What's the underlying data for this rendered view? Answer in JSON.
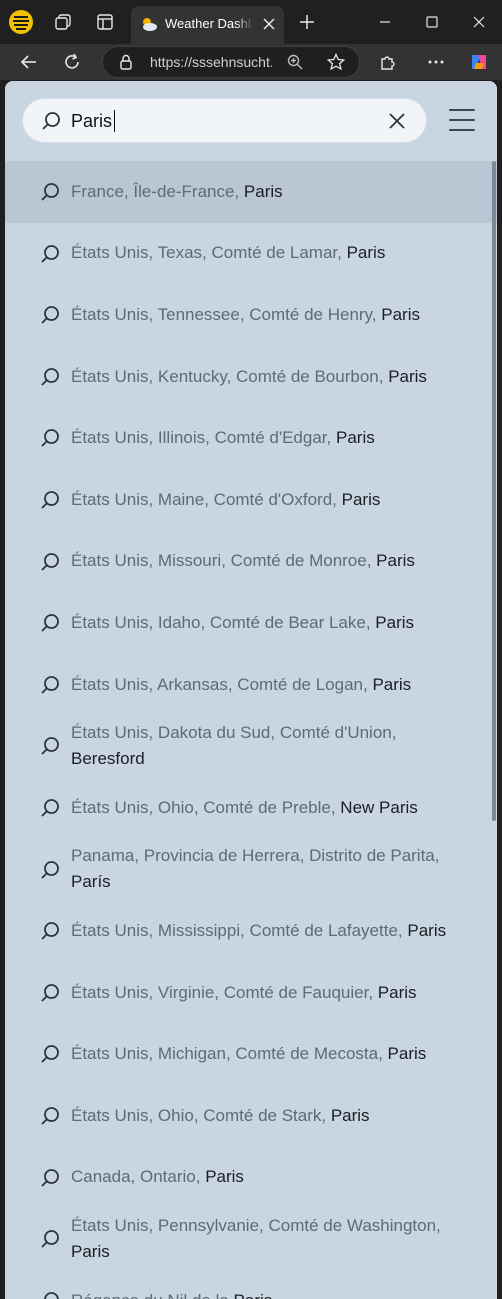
{
  "browser": {
    "tab_title": "Weather Dashboard",
    "url": "https://sssehnsucht.github.io"
  },
  "search": {
    "value": "Paris"
  },
  "results": [
    {
      "region": "France, Île-de-France, ",
      "place": "Paris",
      "selected": true
    },
    {
      "region": "États Unis, Texas, Comté de Lamar, ",
      "place": "Paris"
    },
    {
      "region": "États Unis, Tennessee, Comté de Henry, ",
      "place": "Paris"
    },
    {
      "region": "États Unis, Kentucky, Comté de Bourbon, ",
      "place": "Paris"
    },
    {
      "region": "États Unis, Illinois, Comté d'Edgar, ",
      "place": "Paris"
    },
    {
      "region": "États Unis, Maine, Comté d'Oxford, ",
      "place": "Paris"
    },
    {
      "region": "États Unis, Missouri, Comté de Monroe, ",
      "place": "Paris"
    },
    {
      "region": "États Unis, Idaho, Comté de Bear Lake, ",
      "place": "Paris"
    },
    {
      "region": "États Unis, Arkansas, Comté de Logan, ",
      "place": "Paris"
    },
    {
      "region": "États Unis, Dakota du Sud, Comté d'Union, ",
      "place": "Beresford"
    },
    {
      "region": "États Unis, Ohio, Comté de Preble, ",
      "place": "New Paris"
    },
    {
      "region": "Panama, Provincia de Herrera, Distrito de Parita, ",
      "place": "París"
    },
    {
      "region": "États Unis, Mississippi, Comté de Lafayette, ",
      "place": "Paris"
    },
    {
      "region": "États Unis, Virginie, Comté de Fauquier, ",
      "place": "Paris"
    },
    {
      "region": "États Unis, Michigan, Comté de Mecosta, ",
      "place": "Paris"
    },
    {
      "region": "États Unis, Ohio, Comté de Stark, ",
      "place": "Paris"
    },
    {
      "region": "Canada, Ontario, ",
      "place": "Paris"
    },
    {
      "region": "États Unis, Pennsylvanie, Comté de Washington, ",
      "place": "Paris"
    },
    {
      "region": "Régence du Nil de la ",
      "place": "Paris"
    }
  ],
  "colors": {
    "page_bg": "#c9d5e0",
    "selected_row": "#bac6d3",
    "region_text": "#5d6b79",
    "place_text": "#1a1f25"
  }
}
